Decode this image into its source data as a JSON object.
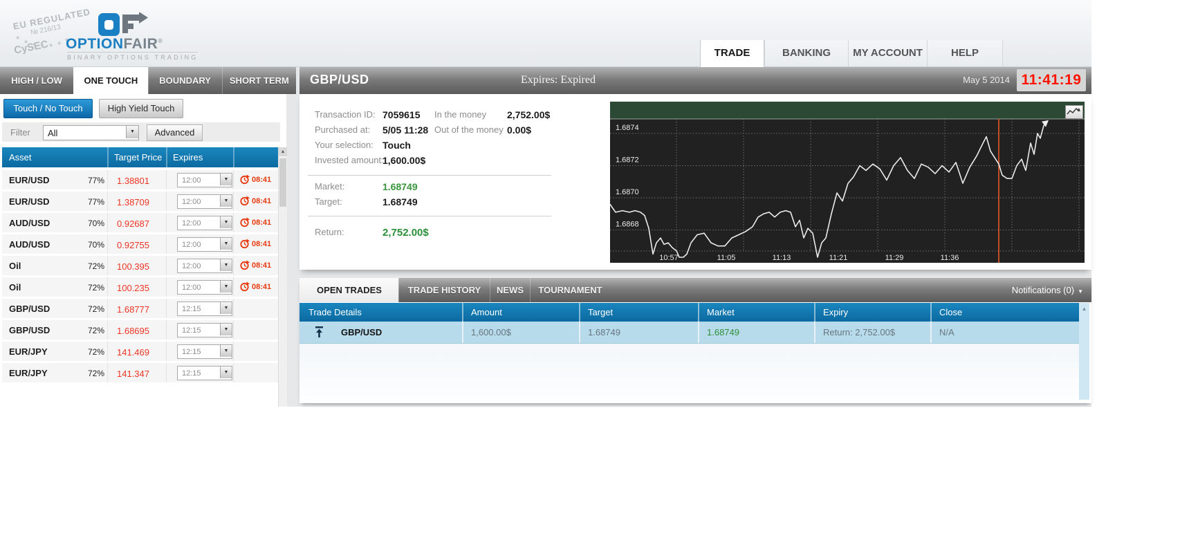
{
  "header": {
    "badge": {
      "line1": "EU REGULATED",
      "line2": "№ 216/13",
      "line3": "CySEC",
      "star": "★"
    },
    "logo": {
      "word_primary": "OPTION",
      "word_secondary": "FAIR",
      "registered": "®",
      "subtitle": "BINARY OPTIONS TRADING"
    },
    "nav_tabs": [
      {
        "label": "TRADE",
        "active": true
      },
      {
        "label": "BANKING",
        "active": false
      },
      {
        "label": "MY ACCOUNT",
        "active": false
      },
      {
        "label": "HELP",
        "active": false
      }
    ]
  },
  "instrument_tabs": [
    {
      "label": "HIGH / LOW",
      "active": false
    },
    {
      "label": "ONE TOUCH",
      "active": true
    },
    {
      "label": "BOUNDARY",
      "active": false
    },
    {
      "label": "SHORT TERM",
      "active": false
    }
  ],
  "symbol_bar": {
    "symbol": "GBP/USD",
    "expires": "Expires:  Expired",
    "date": "May 5 2014",
    "clock": "11:41:19"
  },
  "left_panel": {
    "mode_buttons": [
      {
        "label": "Touch / No Touch",
        "active": true
      },
      {
        "label": "High Yield Touch",
        "active": false
      }
    ],
    "filter": {
      "label": "Filter",
      "selected": "All",
      "advanced_label": "Advanced",
      "dropdown_arrow": "▼"
    },
    "asset_table": {
      "columns": [
        "Asset",
        "Target Price",
        "Expires"
      ],
      "rows": [
        {
          "asset": "EUR/USD",
          "payout": "77%",
          "target_price": "1.38801",
          "expires": "12:00",
          "countdown": "08:41"
        },
        {
          "asset": "EUR/USD",
          "payout": "77%",
          "target_price": "1.38709",
          "expires": "12:00",
          "countdown": "08:41"
        },
        {
          "asset": "AUD/USD",
          "payout": "70%",
          "target_price": "0.92687",
          "expires": "12:00",
          "countdown": "08:41"
        },
        {
          "asset": "AUD/USD",
          "payout": "70%",
          "target_price": "0.92755",
          "expires": "12:00",
          "countdown": "08:41"
        },
        {
          "asset": "Oil",
          "payout": "72%",
          "target_price": "100.395",
          "expires": "12:00",
          "countdown": "08:41"
        },
        {
          "asset": "Oil",
          "payout": "72%",
          "target_price": "100.235",
          "expires": "12:00",
          "countdown": "08:41"
        },
        {
          "asset": "GBP/USD",
          "payout": "72%",
          "target_price": "1.68777",
          "expires": "12:15",
          "countdown": null
        },
        {
          "asset": "GBP/USD",
          "payout": "72%",
          "target_price": "1.68695",
          "expires": "12:15",
          "countdown": null
        },
        {
          "asset": "EUR/JPY",
          "payout": "72%",
          "target_price": "141.469",
          "expires": "12:15",
          "countdown": null
        },
        {
          "asset": "EUR/JPY",
          "payout": "72%",
          "target_price": "141.347",
          "expires": "12:15",
          "countdown": null
        }
      ]
    }
  },
  "trade_details": {
    "rows": [
      {
        "label": "Transaction ID:",
        "value": "7059615"
      },
      {
        "label": "Purchased at:",
        "value": "5/05 11:28"
      },
      {
        "label": "Your selection:",
        "value": "Touch"
      },
      {
        "label": "Invested amount:",
        "value": "1,600.00$"
      }
    ],
    "money_rows": [
      {
        "label": "In the money",
        "value": "2,752.00$"
      },
      {
        "label": "Out of the money",
        "value": "0.00$"
      }
    ],
    "market_label": "Market:",
    "market_value": "1.68749",
    "target_label": "Target:",
    "target_value": "1.68749",
    "return_label": "Return:",
    "return_value": "2,752.00$"
  },
  "chart_data": {
    "type": "line",
    "symbol": "GBP/USD",
    "y_ticks": [
      "1.6874",
      "1.6872",
      "1.6870",
      "1.6868"
    ],
    "x_ticks": [
      "10:57",
      "11:05",
      "11:13",
      "11:21",
      "11:29",
      "11:36"
    ],
    "ylim": [
      1.6866,
      1.68755
    ],
    "grid": true,
    "expiry_marker_x": 1444,
    "series": [
      {
        "name": "GBP/USD price",
        "points": [
          [
            882,
            1.68696
          ],
          [
            885,
            1.68694
          ],
          [
            890,
            1.68691
          ],
          [
            900,
            1.68692
          ],
          [
            910,
            1.68691
          ],
          [
            918,
            1.68692
          ],
          [
            926,
            1.68691
          ],
          [
            932,
            1.68689
          ],
          [
            938,
            1.68681
          ],
          [
            944,
            1.68665
          ],
          [
            949,
            1.68672
          ],
          [
            955,
            1.68675
          ],
          [
            960,
            1.68671
          ],
          [
            966,
            1.68672
          ],
          [
            972,
            1.68669
          ],
          [
            978,
            1.68667
          ],
          [
            982,
            1.68663
          ],
          [
            988,
            1.68663
          ],
          [
            993,
            1.68665
          ],
          [
            999,
            1.68672
          ],
          [
            1008,
            1.68677
          ],
          [
            1018,
            1.68678
          ],
          [
            1028,
            1.68672
          ],
          [
            1038,
            1.6867
          ],
          [
            1048,
            1.6867
          ],
          [
            1058,
            1.68675
          ],
          [
            1068,
            1.68677
          ],
          [
            1078,
            1.68679
          ],
          [
            1088,
            1.68682
          ],
          [
            1096,
            1.68688
          ],
          [
            1104,
            1.6869
          ],
          [
            1112,
            1.68691
          ],
          [
            1120,
            1.68688
          ],
          [
            1128,
            1.68691
          ],
          [
            1136,
            1.68692
          ],
          [
            1143,
            1.68691
          ],
          [
            1150,
            1.68682
          ],
          [
            1156,
            1.68686
          ],
          [
            1162,
            1.68675
          ],
          [
            1168,
            1.68681
          ],
          [
            1175,
            1.68678
          ],
          [
            1182,
            1.68663
          ],
          [
            1188,
            1.68672
          ],
          [
            1194,
            1.68675
          ],
          [
            1202,
            1.6869
          ],
          [
            1210,
            1.68703
          ],
          [
            1218,
            1.68698
          ],
          [
            1226,
            1.68709
          ],
          [
            1234,
            1.68713
          ],
          [
            1243,
            1.6872
          ],
          [
            1252,
            1.68717
          ],
          [
            1262,
            1.68721
          ],
          [
            1272,
            1.68718
          ],
          [
            1282,
            1.68711
          ],
          [
            1292,
            1.6872
          ],
          [
            1302,
            1.68725
          ],
          [
            1312,
            1.68717
          ],
          [
            1322,
            1.68712
          ],
          [
            1332,
            1.68721
          ],
          [
            1342,
            1.68719
          ],
          [
            1352,
            1.68715
          ],
          [
            1362,
            1.6872
          ],
          [
            1372,
            1.68716
          ],
          [
            1382,
            1.68722
          ],
          [
            1392,
            1.68709
          ],
          [
            1402,
            1.68719
          ],
          [
            1412,
            1.68726
          ],
          [
            1420,
            1.68733
          ],
          [
            1426,
            1.68738
          ],
          [
            1432,
            1.68729
          ],
          [
            1438,
            1.68725
          ],
          [
            1444,
            1.68721
          ],
          [
            1449,
            1.68714
          ],
          [
            1456,
            1.68712
          ],
          [
            1463,
            1.68712
          ],
          [
            1470,
            1.6872
          ],
          [
            1477,
            1.68724
          ],
          [
            1483,
            1.68717
          ],
          [
            1490,
            1.68734
          ],
          [
            1495,
            1.68727
          ],
          [
            1500,
            1.6874
          ],
          [
            1504,
            1.68737
          ],
          [
            1509,
            1.68745
          ],
          [
            1514,
            1.68747
          ]
        ]
      }
    ]
  },
  "bottom_panel": {
    "tabs": [
      {
        "label": "OPEN TRADES",
        "active": true
      },
      {
        "label": "TRADE HISTORY",
        "active": false
      },
      {
        "label": "NEWS",
        "active": false
      },
      {
        "label": "TOURNAMENT",
        "active": false
      }
    ],
    "notifications": "Notifications (0)",
    "table": {
      "columns": [
        "Trade Details",
        "Amount",
        "Target",
        "Market",
        "Expiry",
        "Close"
      ],
      "rows": [
        {
          "trade": "GBP/USD",
          "amount": "1,600.00$",
          "target": "1.68749",
          "market": "1.68749",
          "expiry": "Return: 2,752.00$",
          "close": "N/A"
        }
      ]
    }
  },
  "colors": {
    "accent_blue": "#0f76ad",
    "price_red": "#ee3524",
    "clock_red": "#fb1400",
    "green": "#37953c",
    "chart_bg": "#212121",
    "chart_band": "#2c4936",
    "marker_orange": "#bf4d26",
    "open_trade_row": "#b7dbeb"
  }
}
